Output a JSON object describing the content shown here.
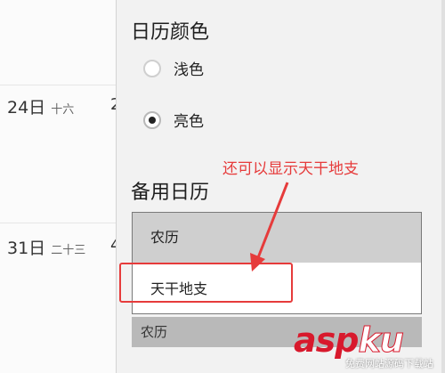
{
  "calendar": {
    "rows": [
      {
        "date": "24日",
        "lunar": "十六",
        "clip": "2"
      },
      {
        "date": "31日",
        "lunar": "二十三",
        "clip": "4"
      }
    ]
  },
  "settings": {
    "calendar_color": {
      "title": "日历颜色",
      "options": [
        {
          "label": "浅色",
          "checked": false
        },
        {
          "label": "亮色",
          "checked": true
        }
      ]
    },
    "alternate_calendar": {
      "title": "备用日历",
      "options": [
        "农历",
        "天干地支"
      ],
      "selected": "农历"
    }
  },
  "annotation": {
    "text": "还可以显示天干地支",
    "color": "#e63b3b"
  },
  "watermark": {
    "brand_a": "asp",
    "brand_b": "ku",
    "tagline": "免费网站源码下载站"
  }
}
